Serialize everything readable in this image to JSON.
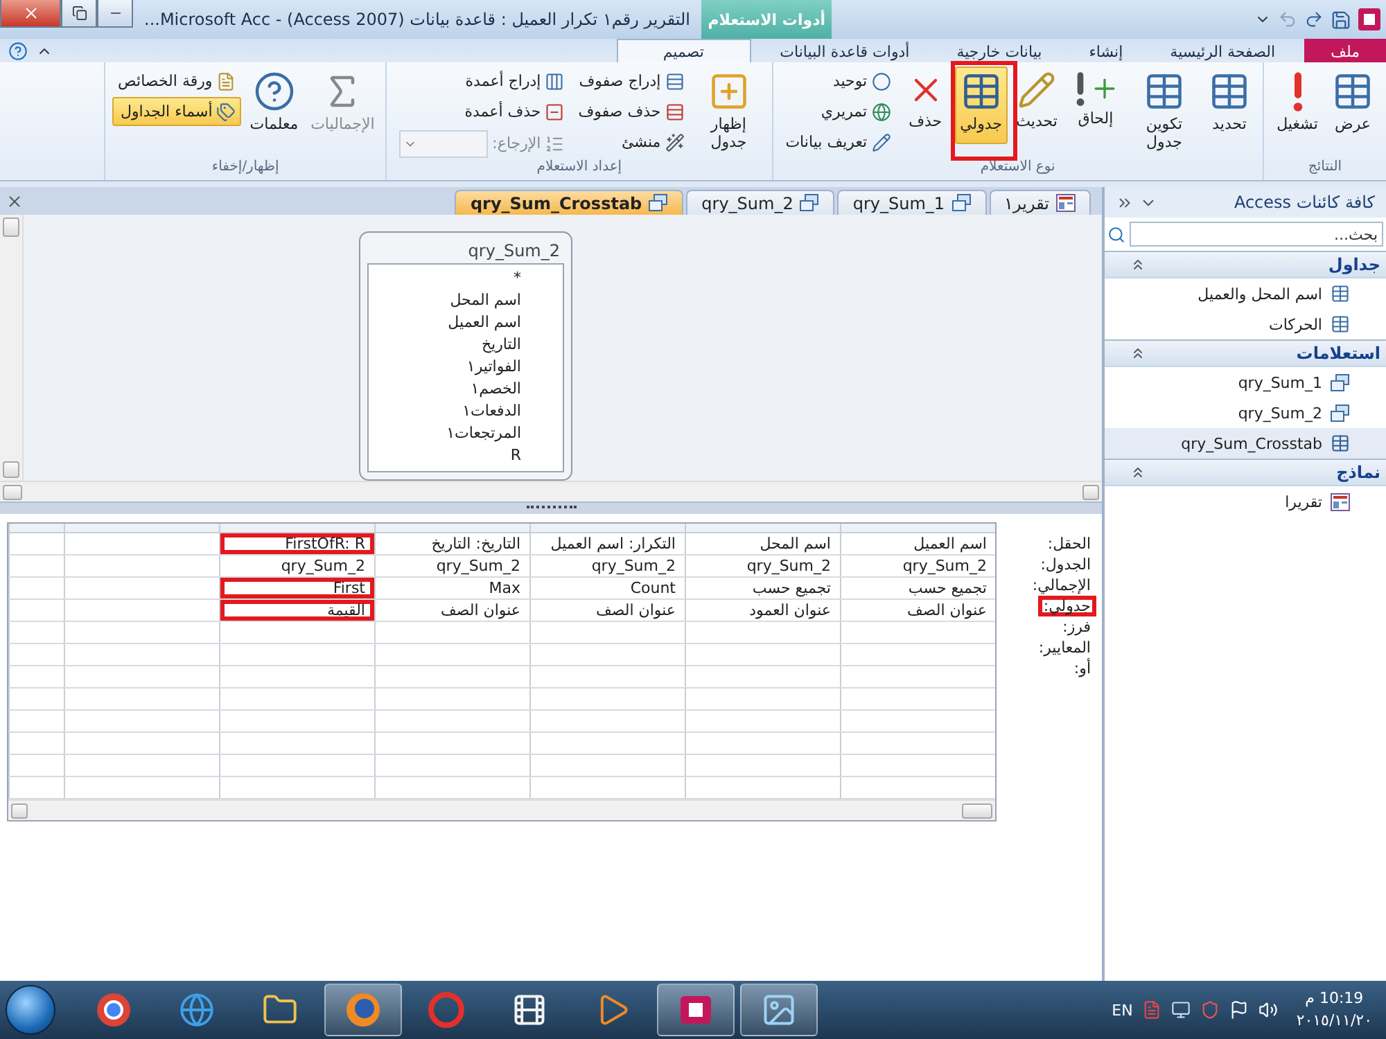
{
  "window": {
    "title": "التقرير رقم١ تكرار العميل : قاعدة بيانات (Access 2007) - Microsoft Acc...",
    "context_tab": "أدوات الاستعلام"
  },
  "ribbon_tabs": [
    {
      "label": "ملف",
      "kind": "file",
      "selected": false
    },
    {
      "label": "الصفحة الرئيسية",
      "kind": "normal",
      "selected": false
    },
    {
      "label": "إنشاء",
      "kind": "normal",
      "selected": false
    },
    {
      "label": "بيانات خارجية",
      "kind": "normal",
      "selected": false
    },
    {
      "label": "أدوات قاعدة البيانات",
      "kind": "normal",
      "selected": false
    },
    {
      "label": "تصميم",
      "kind": "context",
      "selected": true
    }
  ],
  "ribbon_groups": [
    {
      "label": "النتائج",
      "items": [
        {
          "label": "عرض",
          "kind": "large",
          "selected": false,
          "disabled": false
        },
        {
          "label": "تشغيل",
          "kind": "large",
          "selected": false,
          "disabled": false
        }
      ]
    },
    {
      "label": "نوع الاستعلام",
      "items": [
        {
          "label": "تحديد",
          "kind": "large",
          "selected": false,
          "disabled": false
        },
        {
          "label": "تكوين جدول",
          "kind": "large",
          "selected": false,
          "disabled": false
        },
        {
          "label": "إلحاق",
          "kind": "large",
          "selected": false,
          "disabled": false
        },
        {
          "label": "تحديث",
          "kind": "large",
          "selected": false,
          "disabled": false
        },
        {
          "label": "جدولي",
          "kind": "large",
          "selected": true,
          "disabled": false
        },
        {
          "label": "حذف",
          "kind": "large",
          "selected": false,
          "disabled": false
        },
        {
          "label": "توحيد",
          "kind": "small",
          "selected": false,
          "disabled": false
        },
        {
          "label": "تمريري",
          "kind": "small",
          "selected": false,
          "disabled": false
        },
        {
          "label": "تعريف بيانات",
          "kind": "small",
          "selected": false,
          "disabled": false
        }
      ]
    },
    {
      "label": "إعداد الاستعلام",
      "items": [
        {
          "label": "إظهار جدول",
          "kind": "large",
          "selected": false,
          "disabled": false
        },
        {
          "label": "إدراج صفوف",
          "kind": "small",
          "selected": false,
          "disabled": false
        },
        {
          "label": "حذف صفوف",
          "kind": "small",
          "selected": false,
          "disabled": false
        },
        {
          "label": "منشئ",
          "kind": "small",
          "selected": false,
          "disabled": false
        },
        {
          "label": "إدراج أعمدة",
          "kind": "small",
          "selected": false,
          "disabled": false
        },
        {
          "label": "حذف أعمدة",
          "kind": "small",
          "selected": false,
          "disabled": false
        },
        {
          "label": "الإرجاع:",
          "kind": "dropdown",
          "selected": false,
          "disabled": true
        }
      ]
    },
    {
      "label": "إظهار/إخفاء",
      "items": [
        {
          "label": "الإجماليات",
          "kind": "large",
          "selected": false,
          "disabled": true
        },
        {
          "label": "معلمات",
          "kind": "large",
          "selected": false,
          "disabled": false
        },
        {
          "label": "ورقة الخصائص",
          "kind": "small",
          "selected": false,
          "disabled": false
        },
        {
          "label": "أسماء الجداول",
          "kind": "small",
          "selected": true,
          "disabled": false
        }
      ]
    }
  ],
  "doc_tabs": [
    {
      "label": "تقرير١",
      "kind": "report",
      "selected": false
    },
    {
      "label": "qry_Sum_1",
      "kind": "query",
      "selected": false
    },
    {
      "label": "qry_Sum_2",
      "kind": "query",
      "selected": false
    },
    {
      "label": "qry_Sum_Crosstab",
      "kind": "crosstab",
      "selected": true
    }
  ],
  "field_list": {
    "title": "qry_Sum_2",
    "fields": [
      "*",
      "اسم المحل",
      "اسم العميل",
      "التاريخ",
      "الفواتير١",
      "الخصم١",
      "الدفعات١",
      "المرتجعات١",
      "R"
    ]
  },
  "design_grid": {
    "row_labels": [
      {
        "text": "الحقل:",
        "highlighted": false
      },
      {
        "text": "الجدول:",
        "highlighted": false
      },
      {
        "text": "الإجمالي:",
        "highlighted": false
      },
      {
        "text": "جدولي:",
        "highlighted": true
      },
      {
        "text": "فرز:",
        "highlighted": false
      },
      {
        "text": "المعايير:",
        "highlighted": false
      },
      {
        "text": "أو:",
        "highlighted": false
      }
    ],
    "columns": [
      {
        "cells": [
          {
            "text": "اسم العميل",
            "highlighted": false
          },
          {
            "text": "qry_Sum_2",
            "highlighted": false
          },
          {
            "text": "تجميع حسب",
            "highlighted": false
          },
          {
            "text": "عنوان الصف",
            "highlighted": false
          }
        ]
      },
      {
        "cells": [
          {
            "text": "اسم المحل",
            "highlighted": false
          },
          {
            "text": "qry_Sum_2",
            "highlighted": false
          },
          {
            "text": "تجميع حسب",
            "highlighted": false
          },
          {
            "text": "عنوان العمود",
            "highlighted": false
          }
        ]
      },
      {
        "cells": [
          {
            "text": "التكرار: اسم العميل",
            "highlighted": false
          },
          {
            "text": "qry_Sum_2",
            "highlighted": false
          },
          {
            "text": "Count",
            "highlighted": false
          },
          {
            "text": "عنوان الصف",
            "highlighted": false
          }
        ]
      },
      {
        "cells": [
          {
            "text": "التاريخ: التاريخ",
            "highlighted": false
          },
          {
            "text": "qry_Sum_2",
            "highlighted": false
          },
          {
            "text": "Max",
            "highlighted": false
          },
          {
            "text": "عنوان الصف",
            "highlighted": false
          }
        ]
      },
      {
        "cells": [
          {
            "text": "FirstOfR: R",
            "highlighted": true
          },
          {
            "text": "qry_Sum_2",
            "highlighted": false
          },
          {
            "text": "First",
            "highlighted": true
          },
          {
            "text": "القيمة",
            "highlighted": true
          }
        ]
      }
    ]
  },
  "nav_pane": {
    "title": "كافة كائنات Access",
    "search": {
      "placeholder": "بحث..."
    },
    "groups": [
      {
        "label": "جداول",
        "expanded": true,
        "items": [
          {
            "label": "اسم المحل والعميل",
            "kind": "table",
            "selected": false
          },
          {
            "label": "الحركات",
            "kind": "table",
            "selected": false
          }
        ]
      },
      {
        "label": "استعلامات",
        "expanded": true,
        "items": [
          {
            "label": "qry_Sum_1",
            "kind": "query",
            "selected": false
          },
          {
            "label": "qry_Sum_2",
            "kind": "query",
            "selected": false
          },
          {
            "label": "qry_Sum_Crosstab",
            "kind": "crosstab",
            "selected": true
          }
        ]
      },
      {
        "label": "نماذج",
        "expanded": true,
        "items": [
          {
            "label": "تقريرا",
            "kind": "report",
            "selected": false
          }
        ]
      }
    ]
  },
  "taskbar": {
    "apps": [
      {
        "active": false
      },
      {
        "active": false
      },
      {
        "active": false
      },
      {
        "active": true
      },
      {
        "active": false
      },
      {
        "active": false
      },
      {
        "active": false
      },
      {
        "active": true
      },
      {
        "active": true
      }
    ],
    "language": "EN",
    "time": "10:19 م",
    "date": "٢٠١٥/١١/٢٠"
  }
}
